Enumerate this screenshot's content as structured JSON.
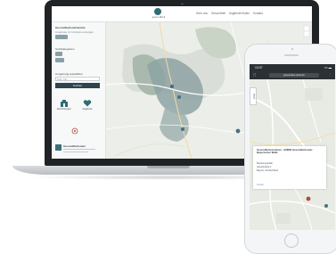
{
  "laptop": {
    "header": {
      "logo_text": "gesundheit",
      "nav_items": [
        "Über uns",
        "Gesundheit",
        "Angebote finden",
        "Kontakt"
      ]
    },
    "sidebar": {
      "heading": "Gesundheitsnetzwerke",
      "subtext": "Angebote im Umkreis anzeigen",
      "filter_label": "Suchkategorien",
      "location_label": "Umgebung auswählen",
      "location_placeholder": "PLZ / Ort",
      "search_button": "Suchen",
      "tile_left_label": "Einrichtungen",
      "tile_right_label": "Angebote",
      "result_label": "Gesundheitsnetz"
    }
  },
  "phone": {
    "status_time": "13:37",
    "status_signal": "▪▪▪ ▬",
    "url": "gesundes-web.de",
    "side_tab_label": "Liste",
    "popup": {
      "title": "Gesundheitszentrum · GNBW Gesundheitsnetz Bayerischer Wald",
      "lines": [
        "Beratungsstelle",
        "Hauptstraße 1",
        "Bayern, Deutschland"
      ],
      "link": "Details"
    }
  },
  "colors": {
    "laptop_body": "#202326",
    "accent": "#2f6d74",
    "map_region": "#8da3a3",
    "sidebar_button": "#2f444c",
    "marker": "#b14a3a"
  }
}
